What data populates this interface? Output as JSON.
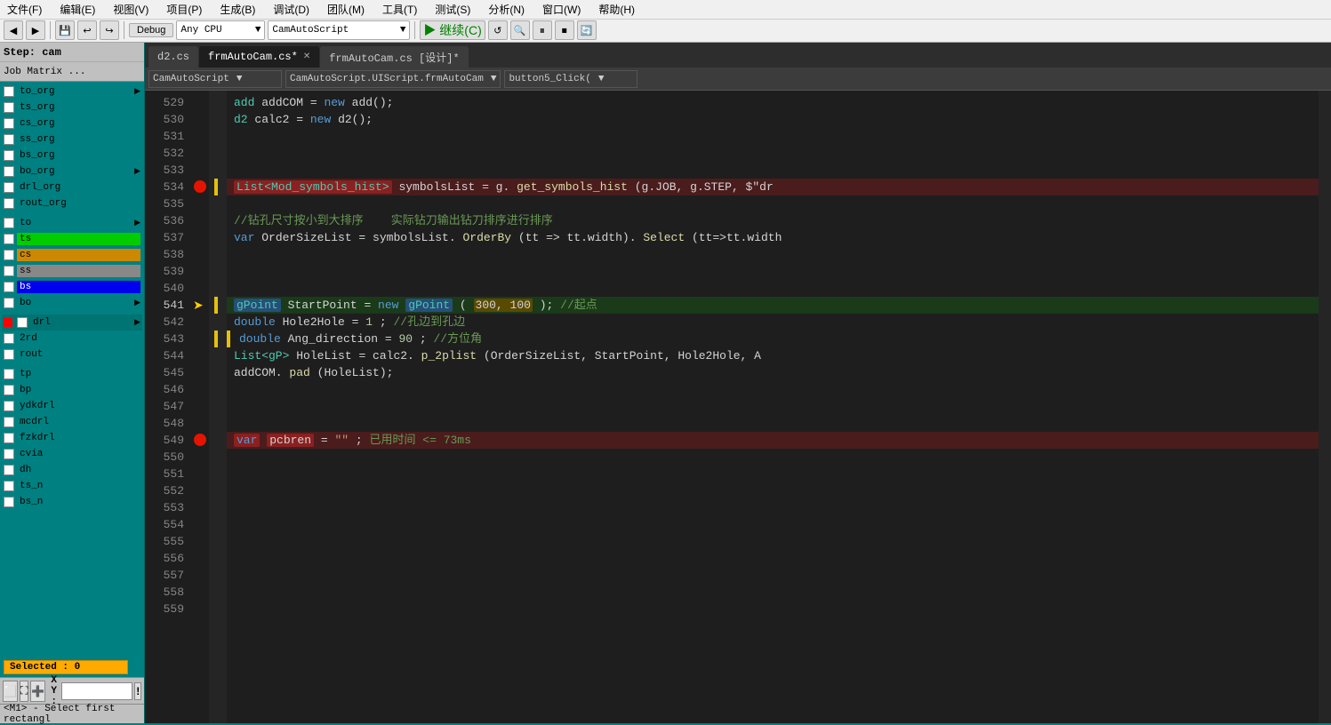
{
  "step": {
    "label": "Step: cam"
  },
  "job_matrix": {
    "label": "Job Matrix ..."
  },
  "menu": {
    "items": [
      "文件(F)",
      "编辑(E)",
      "视图(V)",
      "项目(P)",
      "生成(B)",
      "调试(D)",
      "团队(M)",
      "工具(T)",
      "测试(S)",
      "分析(N)",
      "窗口(W)",
      "帮助(H)"
    ]
  },
  "toolbar": {
    "back_label": "◀",
    "forward_label": "▶",
    "debug_label": "Debug",
    "cpu_label": "Any CPU",
    "script_label": "CamAutoScript",
    "continue_label": "继续(C) ▶",
    "restart_label": "↺",
    "play_label": "▶",
    "pause_label": "⏸",
    "stop_label": "⏹"
  },
  "tabs": [
    {
      "label": "d2.cs",
      "active": false,
      "modified": false,
      "closable": false
    },
    {
      "label": "frmAutoCam.cs*",
      "active": true,
      "modified": true,
      "closable": true
    },
    {
      "label": "frmAutoCam.cs [设计]*",
      "active": false,
      "modified": false,
      "closable": false
    }
  ],
  "code_dropdowns": {
    "scope": "CamAutoScript",
    "class": "CamAutoScript.UIScript.frmAutoCam",
    "method": "button5_Click("
  },
  "layers": {
    "section1": [
      {
        "id": "to_org",
        "label": "to_org",
        "has_arrow": true,
        "checked": true,
        "color": ""
      },
      {
        "id": "ts_org",
        "label": "ts_org",
        "has_arrow": false,
        "checked": true,
        "color": ""
      },
      {
        "id": "cs_org",
        "label": "cs_org",
        "has_arrow": false,
        "checked": true,
        "color": ""
      },
      {
        "id": "ss_org",
        "label": "ss_org",
        "has_arrow": false,
        "checked": true,
        "color": ""
      },
      {
        "id": "bs_org",
        "label": "bs_org",
        "has_arrow": false,
        "checked": true,
        "color": ""
      },
      {
        "id": "bo_org",
        "label": "bo_org",
        "has_arrow": true,
        "checked": true,
        "color": ""
      },
      {
        "id": "drl_org",
        "label": "drl_org",
        "has_arrow": false,
        "checked": true,
        "color": ""
      },
      {
        "id": "rout_org",
        "label": "rout_org",
        "has_arrow": false,
        "checked": true,
        "color": ""
      }
    ],
    "section2": [
      {
        "id": "to",
        "label": "to",
        "has_arrow": true,
        "checked": true,
        "color": ""
      },
      {
        "id": "ts",
        "label": "ts",
        "has_arrow": false,
        "checked": true,
        "color": "#00cc00",
        "colored": true
      },
      {
        "id": "cs",
        "label": "cs",
        "has_arrow": false,
        "checked": true,
        "color": "#cc8800",
        "colored": true
      },
      {
        "id": "ss",
        "label": "ss",
        "has_arrow": false,
        "checked": true,
        "color": "#888888",
        "colored": true
      },
      {
        "id": "bs",
        "label": "bs",
        "has_arrow": false,
        "checked": true,
        "color": "#0000ee",
        "colored": true
      },
      {
        "id": "bo",
        "label": "bo",
        "has_arrow": true,
        "checked": true,
        "color": ""
      }
    ],
    "section3": [
      {
        "id": "drl",
        "label": "drl",
        "has_arrow": true,
        "checked": true,
        "color": "#ff0000",
        "is_drl": true
      },
      {
        "id": "2rd",
        "label": "2rd",
        "has_arrow": false,
        "checked": true,
        "color": ""
      },
      {
        "id": "rout",
        "label": "rout",
        "has_arrow": false,
        "checked": true,
        "color": ""
      }
    ],
    "section4": [
      {
        "id": "tp",
        "label": "tp",
        "has_arrow": false,
        "checked": true,
        "color": ""
      },
      {
        "id": "bp",
        "label": "bp",
        "has_arrow": false,
        "checked": true,
        "color": ""
      },
      {
        "id": "ydkdrl",
        "label": "ydkdrl",
        "has_arrow": false,
        "checked": true,
        "color": ""
      },
      {
        "id": "mcdrl",
        "label": "mcdrl",
        "has_arrow": false,
        "checked": true,
        "color": ""
      },
      {
        "id": "fzkdrl",
        "label": "fzkdrl",
        "has_arrow": false,
        "checked": true,
        "color": ""
      },
      {
        "id": "cvia",
        "label": "cvia",
        "has_arrow": false,
        "checked": true,
        "color": ""
      },
      {
        "id": "dh",
        "label": "dh",
        "has_arrow": false,
        "checked": true,
        "color": ""
      },
      {
        "id": "ts_n",
        "label": "ts_n",
        "has_arrow": false,
        "checked": true,
        "color": ""
      },
      {
        "id": "bs_n",
        "label": "bs_n",
        "has_arrow": false,
        "checked": true,
        "color": ""
      }
    ]
  },
  "selected": {
    "label": "Selected : 0"
  },
  "bottom_toolbar": {
    "xy_label": "X Y :",
    "xy_value": "",
    "status_msg": "<M1> - Select first rectangl"
  },
  "code": {
    "lines": [
      {
        "num": 529,
        "content": "add addCOM = new add();",
        "type": "normal"
      },
      {
        "num": 530,
        "content": "d2 calc2 = new d2();",
        "type": "normal"
      },
      {
        "num": 531,
        "content": "",
        "type": "normal"
      },
      {
        "num": 532,
        "content": "",
        "type": "normal"
      },
      {
        "num": 533,
        "content": "",
        "type": "normal"
      },
      {
        "num": 534,
        "content": "List<Mod_symbols_hist> symbolsList = g.get_symbols_hist(g.JOB, g.STEP, $\"dr",
        "type": "breakpoint",
        "has_breakpoint": true
      },
      {
        "num": 535,
        "content": "",
        "type": "normal"
      },
      {
        "num": 536,
        "content": "//钻孔尺寸按小到大排序    实际钻刀输出钻刀排序进行排序",
        "type": "comment"
      },
      {
        "num": 537,
        "content": "var OrderSizeList = symbolsList.OrderBy(tt => tt.width).Select(tt=>tt.width",
        "type": "normal"
      },
      {
        "num": 538,
        "content": "",
        "type": "normal"
      },
      {
        "num": 539,
        "content": "",
        "type": "normal"
      },
      {
        "num": 540,
        "content": "",
        "type": "normal"
      },
      {
        "num": 541,
        "content": "gPoint StartPoint = new gPoint(300, 100); //起点",
        "type": "arrow",
        "has_arrow": true
      },
      {
        "num": 542,
        "content": "double Hole2Hole = 1;//孔边到孔边",
        "type": "normal"
      },
      {
        "num": 543,
        "content": "double Ang_direction = 90; //方位角",
        "type": "normal",
        "has_yellow_bar": true
      },
      {
        "num": 544,
        "content": "List<gP> HoleList = calc2.p_2plist(OrderSizeList, StartPoint, Hole2Hole, A",
        "type": "normal"
      },
      {
        "num": 545,
        "content": "addCOM.pad(HoleList);",
        "type": "normal"
      },
      {
        "num": 546,
        "content": "",
        "type": "normal"
      },
      {
        "num": 547,
        "content": "",
        "type": "normal"
      },
      {
        "num": 548,
        "content": "",
        "type": "normal"
      },
      {
        "num": 549,
        "content": "var pcbren = \"\";  已用时间 <= 73ms",
        "type": "breakpoint",
        "has_breakpoint": true,
        "has_perf": true
      },
      {
        "num": 550,
        "content": "",
        "type": "normal"
      },
      {
        "num": 551,
        "content": "",
        "type": "normal"
      },
      {
        "num": 552,
        "content": "",
        "type": "normal"
      },
      {
        "num": 553,
        "content": "",
        "type": "normal"
      },
      {
        "num": 554,
        "content": "",
        "type": "normal"
      },
      {
        "num": 555,
        "content": "",
        "type": "normal"
      },
      {
        "num": 556,
        "content": "",
        "type": "normal"
      },
      {
        "num": 557,
        "content": "",
        "type": "normal"
      },
      {
        "num": 558,
        "content": "",
        "type": "normal"
      },
      {
        "num": 559,
        "content": "",
        "type": "normal"
      }
    ]
  }
}
